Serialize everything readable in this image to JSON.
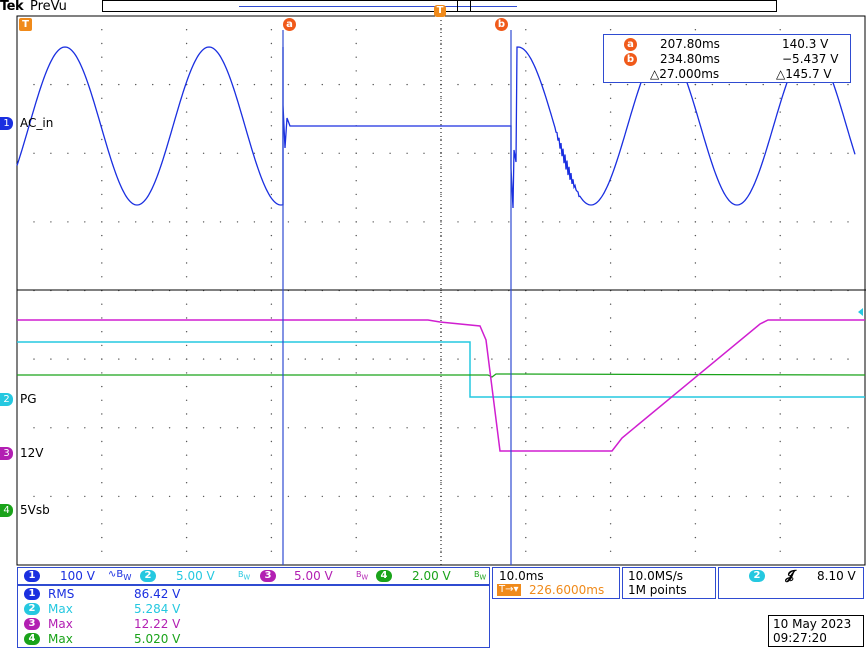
{
  "header": {
    "brand": "Tek",
    "mode": "PreVu"
  },
  "trace_labels": {
    "ch1": "AC_in",
    "ch2": "PG",
    "ch3": "12V",
    "ch4": "5Vsb"
  },
  "markers": {
    "trigger": "T",
    "cursor_a": "a",
    "cursor_b": "b"
  },
  "cursor_readout": {
    "a_time": "207.80ms",
    "a_value": "140.3 V",
    "b_time": "234.80ms",
    "b_value": "−5.437 V",
    "delta_time": "△27.000ms",
    "delta_value": "△145.7 V"
  },
  "channel_scales": [
    {
      "num": "1",
      "scale": "100 V",
      "color": "#1a2fe0"
    },
    {
      "num": "2",
      "scale": "5.00 V",
      "color": "#25c8e0"
    },
    {
      "num": "3",
      "scale": "5.00 V",
      "color": "#b21fb2"
    },
    {
      "num": "4",
      "scale": "2.00 V",
      "color": "#1aa31a"
    }
  ],
  "measurements": [
    {
      "num": "1",
      "type": "RMS",
      "value": "86.42 V",
      "color": "#1a2fe0"
    },
    {
      "num": "2",
      "type": "Max",
      "value": "5.284 V",
      "color": "#25c8e0"
    },
    {
      "num": "3",
      "type": "Max",
      "value": "12.22 V",
      "color": "#b21fb2"
    },
    {
      "num": "4",
      "type": "Max",
      "value": "5.020 V",
      "color": "#1aa31a"
    }
  ],
  "timebase": {
    "scale": "10.0ms",
    "position": "226.6000ms"
  },
  "acquisition": {
    "rate": "10.0MS/s",
    "record": "1M points"
  },
  "trigger": {
    "source": "2",
    "level": "8.10 V"
  },
  "datetime": {
    "date": "10 May 2023",
    "time": "09:27:20"
  },
  "colors": {
    "ch1": "#1a2fe0",
    "ch2": "#25c8e0",
    "ch3": "#d01fd0",
    "ch4": "#1aa31a",
    "cursor": "#f05a1a",
    "panel_border": "#2f4bd1"
  }
}
